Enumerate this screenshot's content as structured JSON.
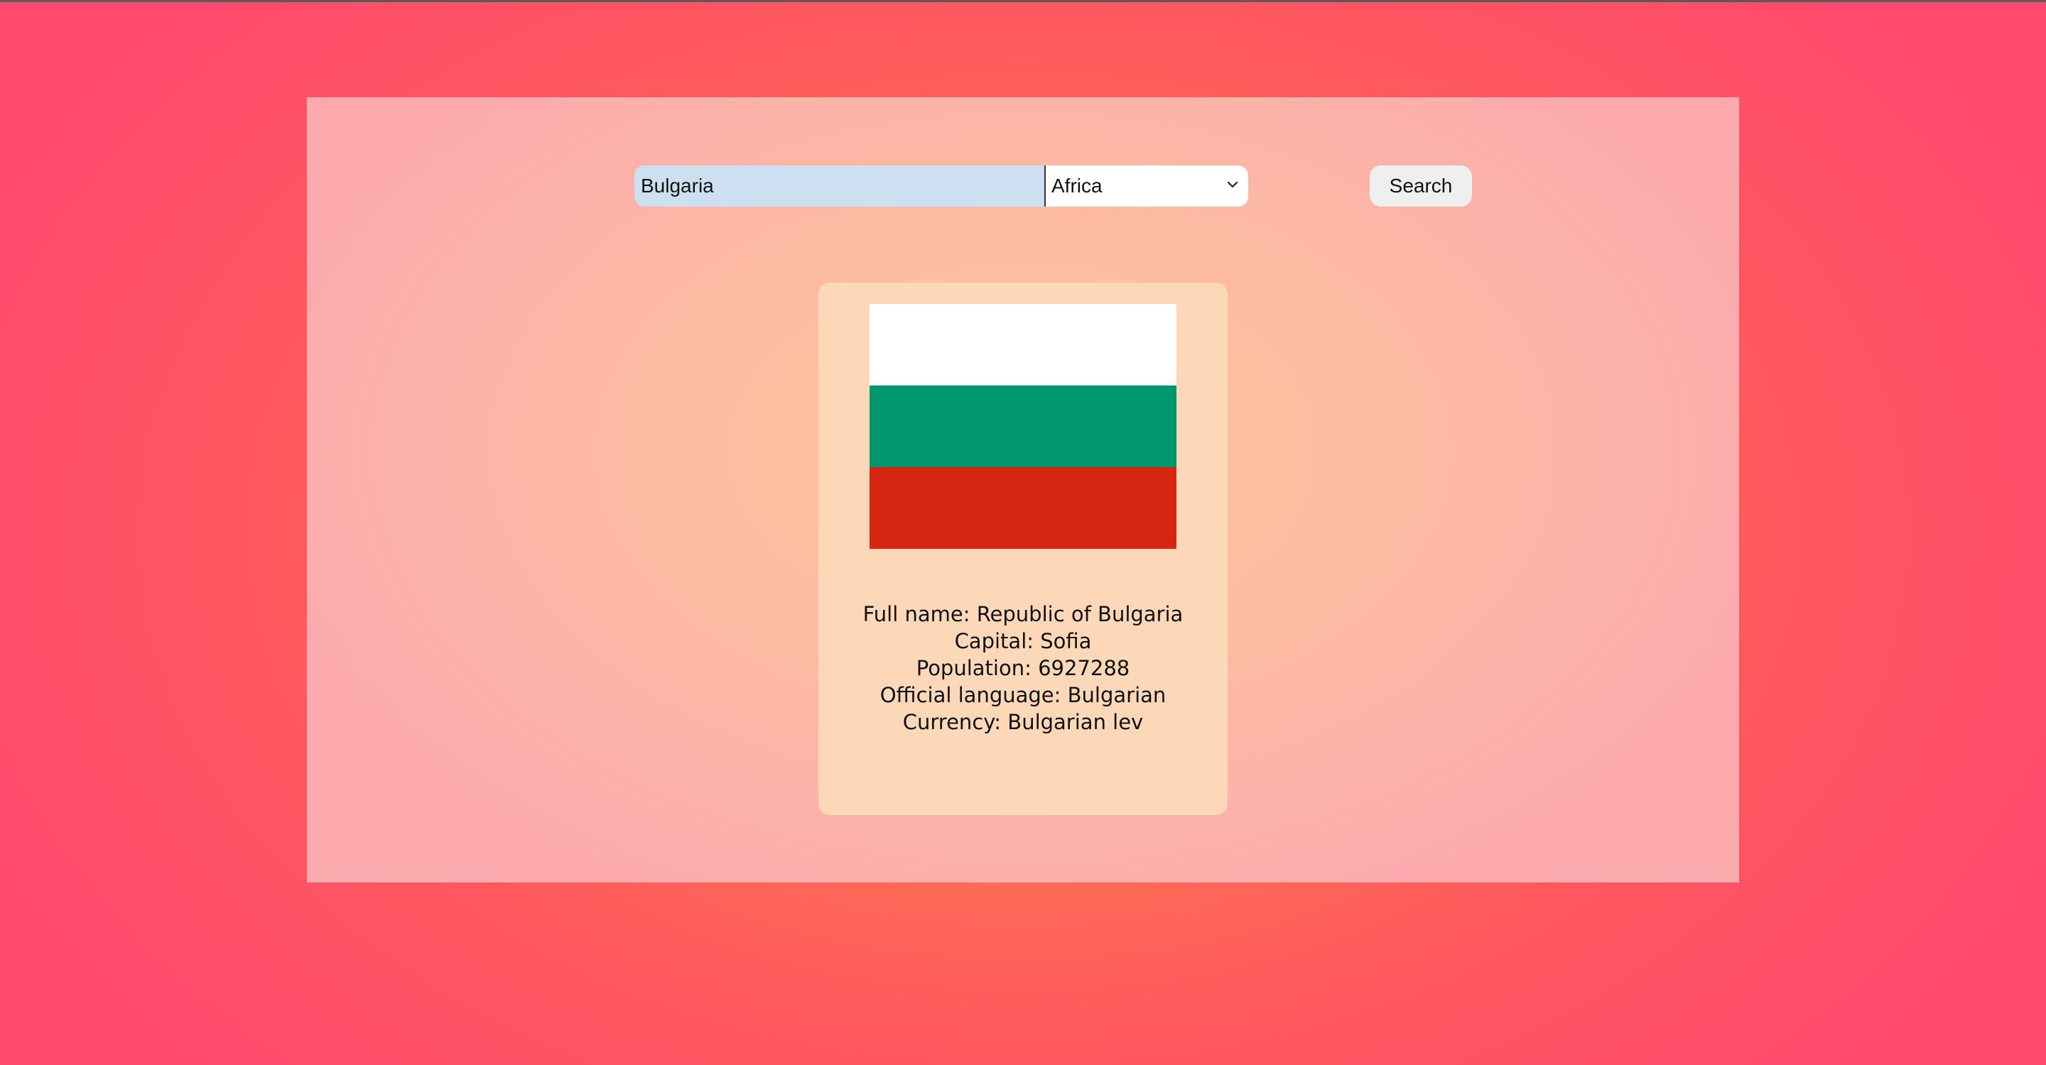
{
  "search": {
    "value": "Bulgaria",
    "button_label": "Search"
  },
  "region": {
    "selected": "Africa"
  },
  "country": {
    "flag_colors": [
      "#ffffff",
      "#00966e",
      "#d62612"
    ],
    "full_name_line": "Full name: Republic of Bulgaria",
    "capital_line": "Capital: Sofia",
    "population_line": "Population: 6927288",
    "language_line": "Official language: Bulgarian",
    "currency_line": "Currency: Bulgarian lev"
  }
}
